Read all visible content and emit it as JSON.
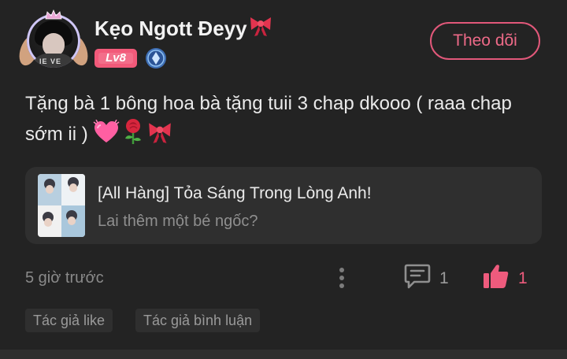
{
  "post": {
    "username": "Kẹo Ngott Đeyy",
    "level": "Lv8",
    "follow_label": "Theo dõi",
    "avatar_shirt_text": "IE VE",
    "comment_text": "Tặng bà 1 bông hoa bà tặng tuii 3 chap dkooo ( raaa chap sớm ii )",
    "emojis": [
      "growing-heart-icon",
      "rose-icon",
      "ribbon-icon"
    ],
    "quoted": {
      "title": "[All Hàng] Tỏa Sáng Trong Lòng Anh!",
      "subtitle": "Lai thêm một bé ngốc?"
    },
    "timestamp": "5 giờ trước",
    "comment_count": "1",
    "like_count": "1",
    "tags": [
      "Tác giả like",
      "Tác giả bình luận"
    ]
  },
  "colors": {
    "background": "#232323",
    "accent": "#ee5b7d",
    "card": "#2f2f2f",
    "level_badge": "#f25a7a",
    "muted_text": "#8a8a8a"
  }
}
